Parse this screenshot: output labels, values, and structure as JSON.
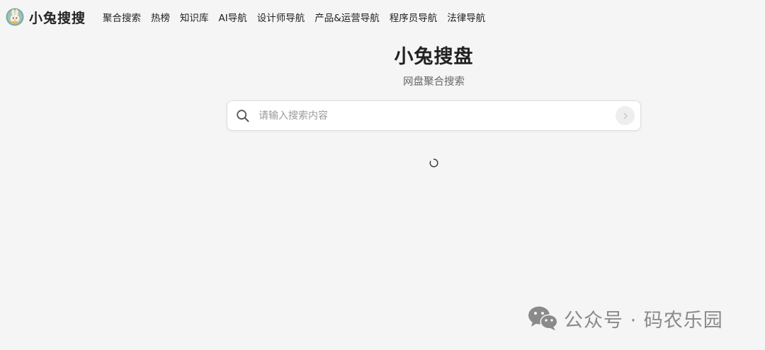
{
  "header": {
    "logo_text": "小兔搜搜",
    "nav": [
      {
        "label": "聚合搜索"
      },
      {
        "label": "热榜"
      },
      {
        "label": "知识库"
      },
      {
        "label": "AI导航"
      },
      {
        "label": "设计师导航"
      },
      {
        "label": "产品&运营导航"
      },
      {
        "label": "程序员导航"
      },
      {
        "label": "法律导航"
      }
    ]
  },
  "hero": {
    "title": "小兔搜盘",
    "subtitle": "网盘聚合搜索"
  },
  "search": {
    "placeholder": "请输入搜索内容",
    "value": ""
  },
  "watermark": {
    "text": "公众号 · 码农乐园"
  },
  "icons": {
    "logo": "rabbit-logo-icon",
    "search": "search-icon",
    "submit": "chevron-right-icon",
    "loading": "loading-spinner-icon",
    "wechat": "wechat-icon"
  },
  "colors": {
    "background": "#f5f5f5",
    "text": "#222222",
    "muted": "#666666",
    "placeholder": "#9a9a9a",
    "watermark": "#8a8a8a"
  }
}
